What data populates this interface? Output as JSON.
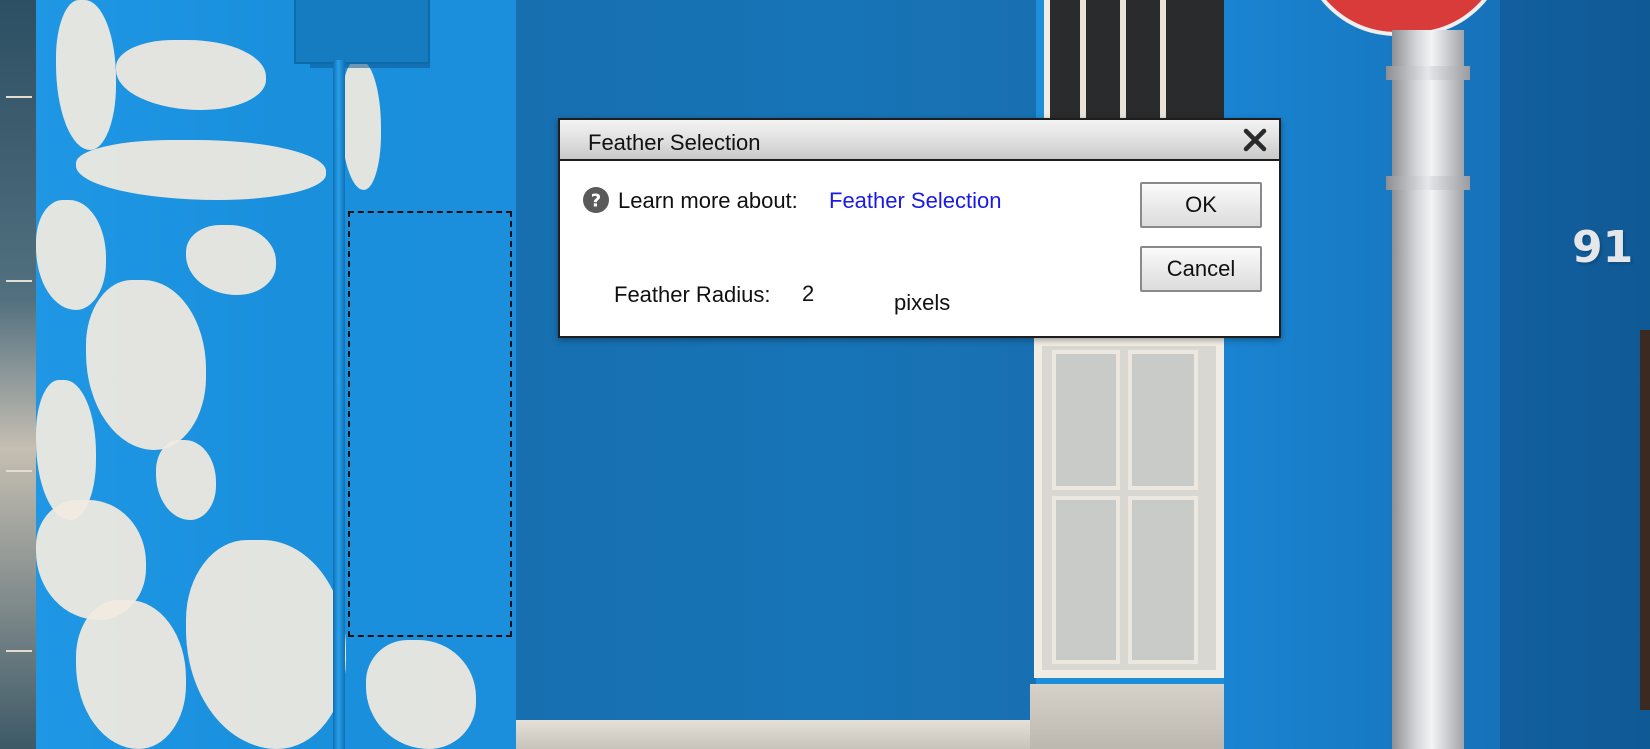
{
  "dialog": {
    "title": "Feather Selection",
    "close_icon": "close-icon",
    "help_icon": "question-circle-icon",
    "learn_more_label": "Learn more about:",
    "learn_more_link": "Feather Selection",
    "feather_radius_label": "Feather Radius:",
    "feather_radius_value": "2",
    "feather_radius_unit": "pixels",
    "ok_label": "OK",
    "cancel_label": "Cancel"
  },
  "background": {
    "house_number": "91"
  },
  "colors": {
    "link": "#1a1ae6",
    "wall_blue": "#1b8fd8",
    "sign_red": "#d93a3a"
  }
}
